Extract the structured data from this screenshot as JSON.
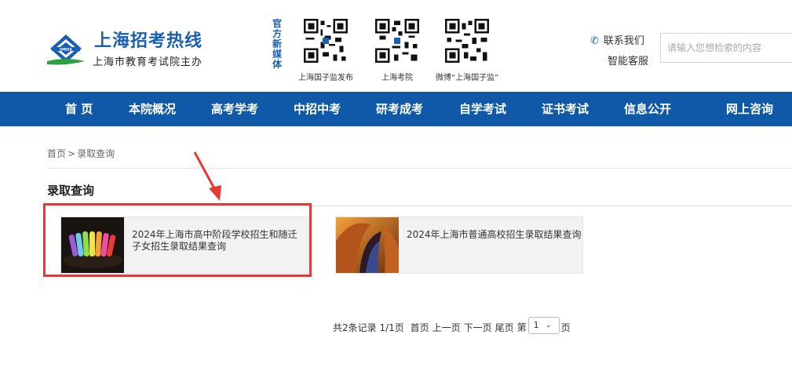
{
  "header": {
    "logo_title": "上海招考热线",
    "logo_sub": "上海市教育考试院主办",
    "media_label": "官方新媒体",
    "qr_codes": [
      {
        "label": "上海国子监发布",
        "icon": "qr-code-icon"
      },
      {
        "label": "上海考院",
        "icon": "qr-code-icon"
      },
      {
        "label": "微博“上海国子监”",
        "icon": "qr-code-icon"
      }
    ],
    "contact_label": "联系我们",
    "service_label": "智能客服",
    "search_placeholder": "请输入您想检索的内容"
  },
  "nav": {
    "items": [
      "首 页",
      "本院概况",
      "高考学考",
      "中招中考",
      "研考成考",
      "自学考试",
      "证书考试",
      "信息公开",
      "网上咨询"
    ]
  },
  "breadcrumb": {
    "home": "首页",
    "sep": ">",
    "current": "录取查询"
  },
  "section": {
    "title": "录取查询"
  },
  "cards": [
    {
      "title": "2024年上海市高中阶段学校招生和随迁子女招生录取结果查询"
    },
    {
      "title": "2024年上海市普通高校招生录取结果查询"
    }
  ],
  "pager": {
    "summary": "共2条记录 1/1页",
    "first": "首页",
    "prev": "上一页",
    "next": "下一页",
    "last": "尾页",
    "page_prefix": "第",
    "page_value": "1",
    "page_suffix": "页"
  },
  "colors": {
    "brand_blue": "#1059a8",
    "highlight_red": "#e53935"
  }
}
